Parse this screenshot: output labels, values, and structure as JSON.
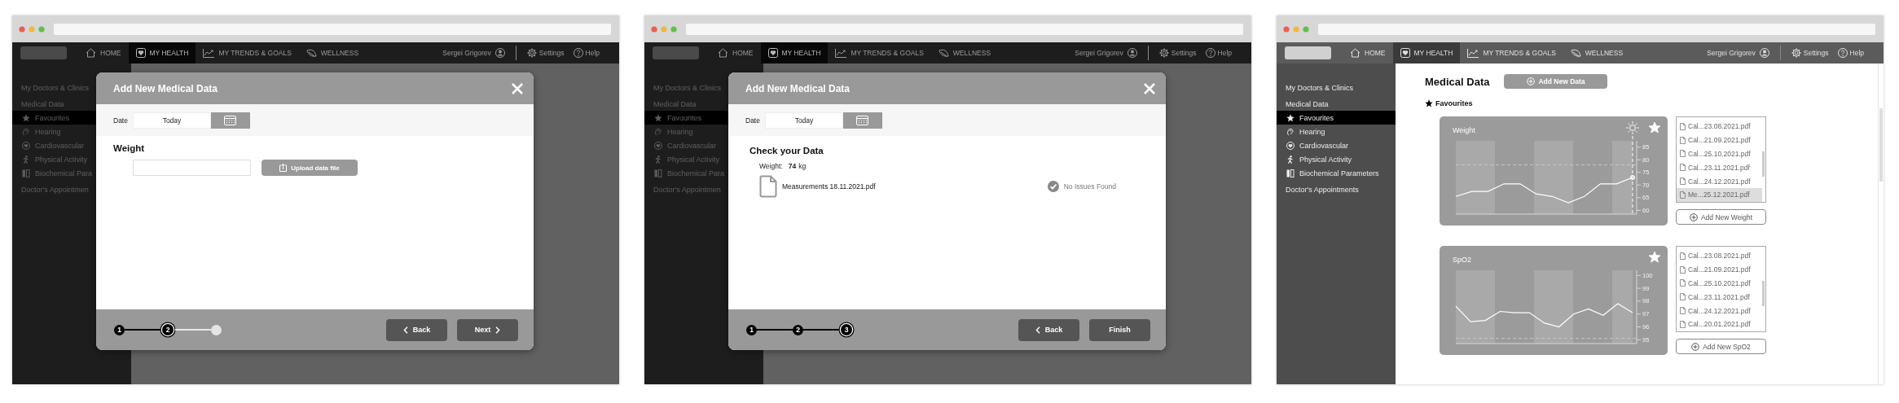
{
  "windows": [
    {
      "dimmed": true,
      "nav": {
        "items": [
          {
            "label": "HOME",
            "selected": false
          },
          {
            "label": "MY HEALTH",
            "selected": true
          },
          {
            "label": "MY TRENDS & GOALS",
            "selected": false
          },
          {
            "label": "WELLNESS",
            "selected": false
          }
        ],
        "user": "Sergei Grigorev",
        "links": [
          "Settings",
          "Help"
        ]
      },
      "sidebar": [
        {
          "label": "My Doctors & Clinics",
          "selected": false
        },
        {
          "label": "Medical Data",
          "selected": false,
          "children": [
            {
              "label": "Favourites",
              "selected": true
            },
            {
              "label": "Hearing",
              "selected": false
            },
            {
              "label": "Cardiovascular",
              "selected": false
            },
            {
              "label": "Physical Activity",
              "selected": false
            },
            {
              "label": "Biochemical Para",
              "selected": false
            }
          ]
        },
        {
          "label": "Doctor's Appointmen",
          "selected": false
        }
      ],
      "modal": {
        "title": "Add New Medical Data",
        "date_label": "Date",
        "date_value": "Today",
        "content": {
          "kind": "upload",
          "heading": "Weight",
          "button": "Upload data file"
        },
        "steps": [
          {
            "label": "1",
            "kind": "done"
          },
          {
            "label": "2",
            "kind": "current"
          },
          {
            "kind": "upcoming"
          }
        ],
        "buttons": [
          {
            "label": "Back",
            "kind": "back"
          },
          {
            "label": "Next",
            "kind": "next"
          }
        ]
      }
    },
    {
      "dimmed": true,
      "nav": {
        "items": [
          {
            "label": "HOME",
            "selected": false
          },
          {
            "label": "MY HEALTH",
            "selected": true
          },
          {
            "label": "MY TRENDS & GOALS",
            "selected": false
          },
          {
            "label": "WELLNESS",
            "selected": false
          }
        ],
        "user": "Sergei Grigorev",
        "links": [
          "Settings",
          "Help"
        ]
      },
      "sidebar": [
        {
          "label": "My Doctors & Clinics",
          "selected": false
        },
        {
          "label": "Medical Data",
          "selected": false,
          "children": [
            {
              "label": "Favourites",
              "selected": true
            },
            {
              "label": "Hearing",
              "selected": false
            },
            {
              "label": "Cardiovascular",
              "selected": false
            },
            {
              "label": "Physical Activity",
              "selected": false
            },
            {
              "label": "Biochemical Para",
              "selected": false
            }
          ]
        },
        {
          "label": "Doctor's Appointmen",
          "selected": false
        }
      ],
      "modal": {
        "title": "Add New Medical Data",
        "date_label": "Date",
        "date_value": "Today",
        "content": {
          "kind": "review",
          "heading": "Check your Data",
          "measure_label": "Weight:",
          "measure_value": "74",
          "measure_unit": "kg",
          "file": "Measurements 18.11.2021.pdf",
          "status": "No Issues Found"
        },
        "steps": [
          {
            "label": "1",
            "kind": "done"
          },
          {
            "label": "2",
            "kind": "done"
          },
          {
            "label": "3",
            "kind": "current"
          }
        ],
        "buttons": [
          {
            "label": "Back",
            "kind": "back"
          },
          {
            "label": "Finish",
            "kind": "finish"
          }
        ]
      }
    },
    {
      "dimmed": false,
      "nav": {
        "items": [
          {
            "label": "HOME",
            "selected": false
          },
          {
            "label": "MY HEALTH",
            "selected": true
          },
          {
            "label": "MY TRENDS & GOALS",
            "selected": false
          },
          {
            "label": "WELLNESS",
            "selected": false
          }
        ],
        "user": "Sergei Grigorev",
        "links": [
          "Settings",
          "Help"
        ]
      },
      "sidebar": [
        {
          "label": "My Doctors & Clinics",
          "selected": false
        },
        {
          "label": "Medical Data",
          "selected": false,
          "children": [
            {
              "label": "Favourites",
              "selected": true
            },
            {
              "label": "Hearing",
              "selected": false
            },
            {
              "label": "Cardiovascular",
              "selected": false
            },
            {
              "label": "Physical Activity",
              "selected": false
            },
            {
              "label": "Biochemical Parameters",
              "selected": false
            }
          ]
        },
        {
          "label": "Doctor's Appointments",
          "selected": false
        }
      ],
      "main": {
        "title": "Medical Data",
        "add_button": "Add New Data",
        "section": "Favourites",
        "cards": [
          {
            "favourite": true,
            "highlight_latest": true,
            "add_button": "Add New Weight",
            "chart_data": {
              "type": "line",
              "title": "Weight",
              "ylim": [
                58.5,
                87.5
              ],
              "yticks": [
                60,
                65,
                70,
                75,
                80,
                85
              ],
              "series": [
                {
                  "color": "#ffffff",
                  "values": [
                    65.5,
                    67.5,
                    67.5,
                    70.5,
                    70.5,
                    66.5,
                    65.5,
                    63,
                    65.5,
                    70.5,
                    70.5,
                    73
                  ]
                }
              ],
              "ref_lines": [
                {
                  "axis": "y",
                  "value": 78
                }
              ]
            },
            "files": [
              {
                "name": "Cal...23.08.2021.pdf",
                "selected": false
              },
              {
                "name": "Cal...21.09.2021.pdf",
                "selected": false
              },
              {
                "name": "Cal...25.10.2021.pdf",
                "selected": false
              },
              {
                "name": "Cal...23.11.2021.pdf",
                "selected": false
              },
              {
                "name": "Cal...24.12.2021.pdf",
                "selected": false
              },
              {
                "name": "Me...25.12.2021.pdf",
                "selected": true
              }
            ]
          },
          {
            "favourite": true,
            "highlight_latest": false,
            "add_button": "Add New SpO2",
            "chart_data": {
              "type": "line",
              "title": "SpO2",
              "ylim": [
                94.7,
                100.4
              ],
              "yticks": [
                95,
                96,
                97,
                98,
                99,
                100
              ],
              "series": [
                {
                  "color": "#ffffff",
                  "values": [
                    97.6,
                    96.4,
                    96.5,
                    97.2,
                    97.1,
                    97.1,
                    96.3,
                    96.0,
                    97.0,
                    97.4,
                    96.9,
                    97.8,
                    97.1
                  ]
                }
              ],
              "ref_lines": [
                {
                  "axis": "y",
                  "value": 95.1
                }
              ]
            },
            "files": [
              {
                "name": "Cal...23.08.2021.pdf",
                "selected": false
              },
              {
                "name": "Cal...21.09.2021.pdf",
                "selected": false
              },
              {
                "name": "Cal...25.10.2021.pdf",
                "selected": false
              },
              {
                "name": "Cal...23.11.2021.pdf",
                "selected": false
              },
              {
                "name": "Cal...24.12.2021.pdf",
                "selected": false
              },
              {
                "name": "Cal...20.01.2021.pdf",
                "selected": false
              }
            ]
          }
        ]
      }
    }
  ]
}
